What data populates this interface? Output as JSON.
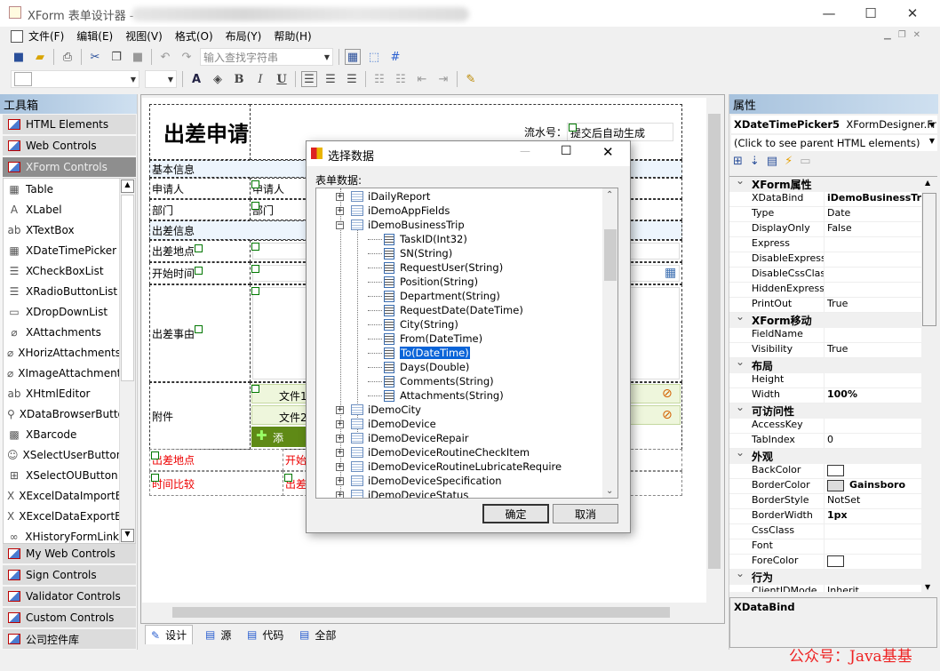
{
  "window": {
    "title": "XForm 表单设计器 -",
    "minimize": "—",
    "maximize": "☐",
    "close": "✕"
  },
  "menu": [
    "文件(F)",
    "编辑(E)",
    "视图(V)",
    "格式(O)",
    "布局(Y)",
    "帮助(H)"
  ],
  "toolbar": {
    "search_placeholder": "输入查找字符串",
    "bold": "B",
    "italic": "I",
    "underline": "U"
  },
  "toolbox": {
    "title": "工具箱",
    "top_categories": [
      "HTML Elements",
      "Web Controls",
      "XForm Controls"
    ],
    "items": [
      {
        "label": "Table",
        "icon": "table-icon",
        "g": "▦"
      },
      {
        "label": "XLabel",
        "icon": "label-icon",
        "g": "A"
      },
      {
        "label": "XTextBox",
        "icon": "textbox-icon",
        "g": "ab"
      },
      {
        "label": "XDateTimePicker",
        "icon": "calendar-icon",
        "g": "▦"
      },
      {
        "label": "XCheckBoxList",
        "icon": "checklist-icon",
        "g": "☰"
      },
      {
        "label": "XRadioButtonList",
        "icon": "radiolist-icon",
        "g": "☰"
      },
      {
        "label": "XDropDownList",
        "icon": "dropdown-icon",
        "g": "▭"
      },
      {
        "label": "XAttachments",
        "icon": "paperclip-icon",
        "g": "⌀"
      },
      {
        "label": "XHorizAttachments",
        "icon": "paperclip-icon",
        "g": "⌀"
      },
      {
        "label": "XImageAttachment",
        "icon": "paperclip-icon",
        "g": "⌀"
      },
      {
        "label": "XHtmlEditor",
        "icon": "editor-icon",
        "g": "ab"
      },
      {
        "label": "XDataBrowserButton",
        "icon": "search-icon",
        "g": "⚲"
      },
      {
        "label": "XBarcode",
        "icon": "qrcode-icon",
        "g": "▩"
      },
      {
        "label": "XSelectUserButton",
        "icon": "user-icon",
        "g": "☺"
      },
      {
        "label": "XSelectOUButton",
        "icon": "org-chart-icon",
        "g": "⊞"
      },
      {
        "label": "XExcelDataImportB...",
        "icon": "excel-icon",
        "g": "X"
      },
      {
        "label": "XExcelDataExportB...",
        "icon": "excel-icon",
        "g": "X"
      },
      {
        "label": "XHistoryFormLink",
        "icon": "link-icon",
        "g": "∞"
      }
    ],
    "bottom_categories": [
      "My Web Controls",
      "Sign Controls",
      "Validator Controls",
      "Custom Controls",
      "公司控件库"
    ]
  },
  "form": {
    "title": "出差申请",
    "serial_label": "流水号：",
    "serial_value": "提交后自动生成",
    "section_basic": "基本信息",
    "applicant": "申请人",
    "applicant_value": "申请人",
    "dept": "部门",
    "dept_value": "部门",
    "section_trip": "出差信息",
    "place": "出差地点",
    "start": "开始时间",
    "reason": "出差事由",
    "attach": "附件",
    "file1": "文件1",
    "file2": "文件2",
    "add_attach": "添加附",
    "red_row1_a": "出差地点",
    "red_row1_b": "开始",
    "red_row2_a": "时间比较",
    "red_row2_b": "出差"
  },
  "dialog": {
    "title": "选择数据",
    "label": "表单数据:",
    "ok": "确定",
    "cancel": "取消",
    "tree": [
      {
        "t": "iDailyReport",
        "lvl": 0,
        "pm": "+"
      },
      {
        "t": "iDemoAppFields",
        "lvl": 0,
        "pm": "+"
      },
      {
        "t": "iDemoBusinessTrip",
        "lvl": 0,
        "pm": "−"
      },
      {
        "t": "TaskID(Int32)",
        "lvl": 1
      },
      {
        "t": "SN(String)",
        "lvl": 1
      },
      {
        "t": "RequestUser(String)",
        "lvl": 1
      },
      {
        "t": "Position(String)",
        "lvl": 1
      },
      {
        "t": "Department(String)",
        "lvl": 1
      },
      {
        "t": "RequestDate(DateTime)",
        "lvl": 1
      },
      {
        "t": "City(String)",
        "lvl": 1
      },
      {
        "t": "From(DateTime)",
        "lvl": 1
      },
      {
        "t": "To(DateTime)",
        "lvl": 1,
        "selected": true
      },
      {
        "t": "Days(Double)",
        "lvl": 1
      },
      {
        "t": "Comments(String)",
        "lvl": 1
      },
      {
        "t": "Attachments(String)",
        "lvl": 1
      },
      {
        "t": "iDemoCity",
        "lvl": 0,
        "pm": "+"
      },
      {
        "t": "iDemoDevice",
        "lvl": 0,
        "pm": "+"
      },
      {
        "t": "iDemoDeviceRepair",
        "lvl": 0,
        "pm": "+"
      },
      {
        "t": "iDemoDeviceRoutineCheckItem",
        "lvl": 0,
        "pm": "+"
      },
      {
        "t": "iDemoDeviceRoutineLubricateRequire",
        "lvl": 0,
        "pm": "+"
      },
      {
        "t": "iDemoDeviceSpecification",
        "lvl": 0,
        "pm": "+"
      },
      {
        "t": "iDemoDeviceStatus",
        "lvl": 0,
        "pm": "+"
      }
    ]
  },
  "properties": {
    "title": "属性",
    "object_name": "XDateTimePicker5",
    "object_type": "XFormDesigner.Fr",
    "parent_hint": "(Click to see parent HTML elements)",
    "rows": [
      {
        "cat": "XForm属性"
      },
      {
        "k": "XDataBind",
        "v": "iDemoBusinessTrip",
        "b": true
      },
      {
        "k": "Type",
        "v": "Date"
      },
      {
        "k": "DisplayOnly",
        "v": "False"
      },
      {
        "k": "Express",
        "v": ""
      },
      {
        "k": "DisableExpress",
        "v": ""
      },
      {
        "k": "DisableCssClass",
        "v": ""
      },
      {
        "k": "HiddenExpress",
        "v": ""
      },
      {
        "k": "PrintOut",
        "v": "True"
      },
      {
        "cat": "XForm移动"
      },
      {
        "k": "FieldName",
        "v": ""
      },
      {
        "k": "Visibility",
        "v": "True"
      },
      {
        "cat": "布局"
      },
      {
        "k": "Height",
        "v": ""
      },
      {
        "k": "Width",
        "v": "100%",
        "b": true
      },
      {
        "cat": "可访问性"
      },
      {
        "k": "AccessKey",
        "v": ""
      },
      {
        "k": "TabIndex",
        "v": "0"
      },
      {
        "cat": "外观"
      },
      {
        "k": "BackColor",
        "v": "",
        "sw": "#ffffff"
      },
      {
        "k": "BorderColor",
        "v": "Gainsboro",
        "b": true,
        "sw": "#dcdcdc"
      },
      {
        "k": "BorderStyle",
        "v": "NotSet"
      },
      {
        "k": "BorderWidth",
        "v": "1px",
        "b": true
      },
      {
        "k": "CssClass",
        "v": ""
      },
      {
        "k": "Font",
        "v": ""
      },
      {
        "k": "ForeColor",
        "v": "",
        "sw": "#ffffff"
      },
      {
        "cat": "行为"
      },
      {
        "k": "ClientIDMode",
        "v": "Inherit"
      }
    ],
    "desc_title": "XDataBind"
  },
  "tabs": [
    "设计",
    "源",
    "代码",
    "全部"
  ],
  "watermark": "公众号：Java基基"
}
